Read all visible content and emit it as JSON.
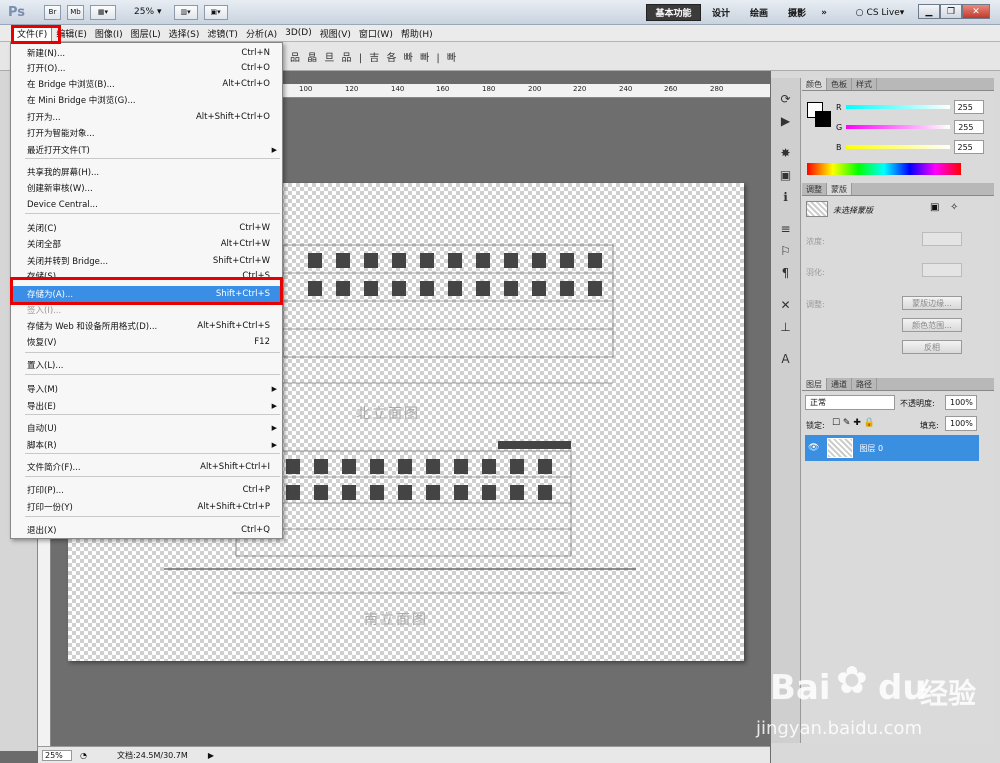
{
  "app": {
    "logo": "Ps",
    "zoom": "25%",
    "workspaces": [
      "基本功能",
      "设计",
      "绘画",
      "摄影"
    ],
    "more": "»",
    "cslive": "CS Live",
    "appbar_icons": [
      "Br",
      "Mb"
    ],
    "options_glyphs": "品 晶 旦 品 | 吉 各 빠 빠 | 빠"
  },
  "menubar": [
    "文件(F)",
    "编辑(E)",
    "图像(I)",
    "图层(L)",
    "选择(S)",
    "滤镜(T)",
    "分析(A)",
    "3D(D)",
    "视图(V)",
    "窗口(W)",
    "帮助(H)"
  ],
  "file_menu": [
    {
      "label": "新建(N)...",
      "shortcut": "Ctrl+N"
    },
    {
      "label": "打开(O)...",
      "shortcut": "Ctrl+O"
    },
    {
      "label": "在 Bridge 中浏览(B)...",
      "shortcut": "Alt+Ctrl+O"
    },
    {
      "label": "在 Mini Bridge 中浏览(G)...",
      "shortcut": ""
    },
    {
      "label": "打开为...",
      "shortcut": "Alt+Shift+Ctrl+O"
    },
    {
      "label": "打开为智能对象...",
      "shortcut": ""
    },
    {
      "label": "最近打开文件(T)",
      "shortcut": "",
      "submenu": true
    },
    {
      "label": "共享我的屏幕(H)...",
      "shortcut": ""
    },
    {
      "label": "创建新审核(W)...",
      "shortcut": ""
    },
    {
      "label": "Device Central...",
      "shortcut": ""
    },
    {
      "label": "关闭(C)",
      "shortcut": "Ctrl+W"
    },
    {
      "label": "关闭全部",
      "shortcut": "Alt+Ctrl+W"
    },
    {
      "label": "关闭并转到 Bridge...",
      "shortcut": "Shift+Ctrl+W"
    },
    {
      "label": "存储(S)",
      "shortcut": "Ctrl+S"
    },
    {
      "label": "存储为(A)...",
      "shortcut": "Shift+Ctrl+S",
      "highlighted": true
    },
    {
      "label": "签入(I)...",
      "shortcut": "",
      "disabled": true
    },
    {
      "label": "存储为 Web 和设备所用格式(D)...",
      "shortcut": "Alt+Shift+Ctrl+S"
    },
    {
      "label": "恢复(V)",
      "shortcut": "F12"
    },
    {
      "label": "置入(L)...",
      "shortcut": ""
    },
    {
      "label": "导入(M)",
      "shortcut": "",
      "submenu": true
    },
    {
      "label": "导出(E)",
      "shortcut": "",
      "submenu": true
    },
    {
      "label": "自动(U)",
      "shortcut": "",
      "submenu": true
    },
    {
      "label": "脚本(R)",
      "shortcut": "",
      "submenu": true
    },
    {
      "label": "文件简介(F)...",
      "shortcut": "Alt+Shift+Ctrl+I"
    },
    {
      "label": "打印(P)...",
      "shortcut": "Ctrl+P"
    },
    {
      "label": "打印一份(Y)",
      "shortcut": "Alt+Shift+Ctrl+P"
    },
    {
      "label": "退出(X)",
      "shortcut": "Ctrl+Q"
    }
  ],
  "ruler_ticks": [
    "100",
    "120",
    "140",
    "160",
    "180",
    "200",
    "220",
    "240",
    "260",
    "280"
  ],
  "statusbar": {
    "zoom": "25%",
    "doc": "文档:24.5M/30.7M"
  },
  "color_panel": {
    "tabs": [
      "颜色",
      "色板",
      "样式"
    ],
    "r_label": "R",
    "g_label": "G",
    "b_label": "B",
    "r": "255",
    "g": "255",
    "b": "255"
  },
  "masks_panel": {
    "tabs": [
      "调整",
      "蒙版"
    ],
    "no_selection": "未选择蒙版",
    "density": "浓度:",
    "feather": "羽化:",
    "refine": "调整:",
    "btn_edge": "蒙版边缘...",
    "btn_range": "颜色范围...",
    "btn_invert": "反相"
  },
  "layers_panel": {
    "tabs": [
      "图层",
      "通道",
      "路径"
    ],
    "blend": "正常",
    "opacity_label": "不透明度:",
    "opacity": "100%",
    "lock_label": "锁定:",
    "fill_label": "填充:",
    "fill": "100%",
    "layer_name": "图层 0"
  },
  "drawing_labels": [
    "北立面图",
    "南立面图"
  ],
  "watermark": {
    "brand": "Bai",
    "brand2": "du",
    "cn": "经验",
    "url": "jingyan.baidu.com"
  },
  "colors": {
    "highlight": "#3a8ee6",
    "red_box": "#e60000",
    "layer_selected": "#3b8fe0"
  }
}
